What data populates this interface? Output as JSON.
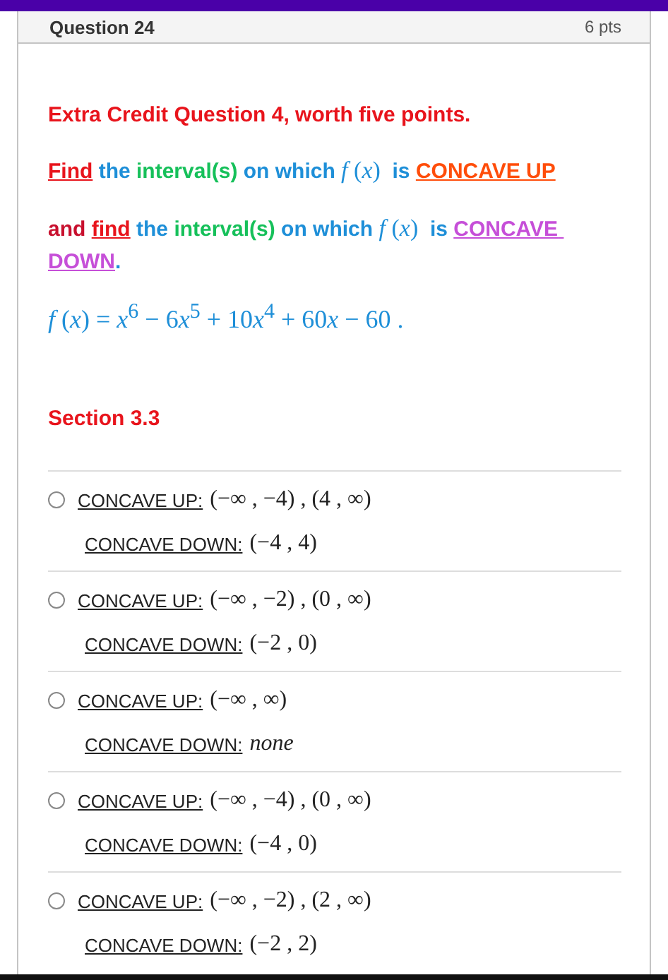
{
  "header": {
    "title": "Question 24",
    "points": "6 pts"
  },
  "question": {
    "title": "Extra Credit Question 4, worth five points.",
    "paragraphs": [
      [
        {
          "kind": "word",
          "text": "Find",
          "color": "#e8141c",
          "underline": true
        },
        {
          "kind": "word",
          "text": " the ",
          "color": "#1e8fd8",
          "underline": false
        },
        {
          "kind": "word",
          "text": "interval(s)",
          "color": "#16c05a",
          "underline": false
        },
        {
          "kind": "word",
          "text": " on which ",
          "color": "#1e8fd8",
          "underline": false
        },
        {
          "kind": "math",
          "text": "*f* (*x*)",
          "color": "#1e8fd8",
          "underline": false
        },
        {
          "kind": "word",
          "text": "  is ",
          "color": "#1e8fd8",
          "underline": false
        },
        {
          "kind": "word",
          "text": "CONCAVE UP",
          "color": "#ff4d0a",
          "underline": true
        }
      ],
      [
        {
          "kind": "word",
          "text": "and ",
          "color": "#c8102e",
          "underline": false
        },
        {
          "kind": "word",
          "text": "find",
          "color": "#e8141c",
          "underline": true
        },
        {
          "kind": "word",
          "text": " the ",
          "color": "#1e8fd8",
          "underline": false
        },
        {
          "kind": "word",
          "text": "interval(s)",
          "color": "#16c05a",
          "underline": false
        },
        {
          "kind": "word",
          "text": " on which ",
          "color": "#1e8fd8",
          "underline": false
        },
        {
          "kind": "math",
          "text": "*f* (*x*)",
          "color": "#1e8fd8",
          "underline": false
        },
        {
          "kind": "word",
          "text": "  is ",
          "color": "#1e8fd8",
          "underline": false
        },
        {
          "kind": "word",
          "text": "CONCAVE DOWN",
          "color": "#c64fd8",
          "underline": true
        },
        {
          "kind": "word",
          "text": ".",
          "color": "#1e8fd8",
          "underline": false
        }
      ]
    ],
    "equation": [
      "*f* (*x*) = *x*$^{6}$ − 6",
      "*x*$^{5}$ + 10",
      "*x*$^{4}$ + 60",
      "*x* − 60 ."
    ],
    "section": "Section 3.3"
  },
  "options": [
    {
      "selected": false,
      "up_label": "CONCAVE UP:",
      "up_value": "(−∞ , −4) , (4 , ∞)",
      "down_label": "CONCAVE DOWN:",
      "down_value": "(−4 , 4)",
      "down_italic": false
    },
    {
      "selected": false,
      "up_label": "CONCAVE UP:",
      "up_value": "(−∞ , −2) , (0 , ∞)",
      "down_label": "CONCAVE DOWN:",
      "down_value": "(−2 , 0)",
      "down_italic": false
    },
    {
      "selected": false,
      "up_label": "CONCAVE UP:",
      "up_value": "(−∞ , ∞)",
      "down_label": "CONCAVE DOWN:",
      "down_value": "none",
      "down_italic": true
    },
    {
      "selected": false,
      "up_label": "CONCAVE UP:",
      "up_value": "(−∞ , −4) , (0 , ∞)",
      "down_label": "CONCAVE DOWN:",
      "down_value": "(−4 , 0)",
      "down_italic": false
    },
    {
      "selected": false,
      "up_label": "CONCAVE UP:",
      "up_value": "(−∞ , −2) , (2 , ∞)",
      "down_label": "CONCAVE DOWN:",
      "down_value": "(−2 , 2)",
      "down_italic": false
    }
  ]
}
